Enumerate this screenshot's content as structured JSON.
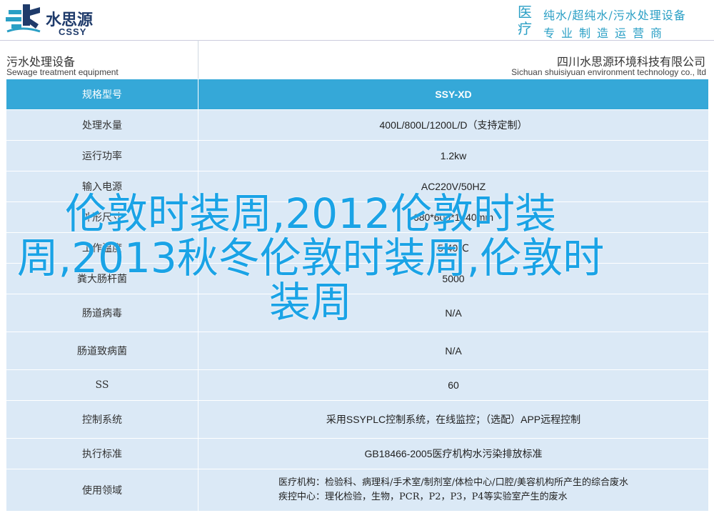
{
  "brand": {
    "name_cn": "水思源",
    "name_en": "CSSY"
  },
  "slogan": {
    "big": "医疗",
    "line1": "纯水/超纯水/污水处理设备",
    "line2": "专业制造运营商"
  },
  "header": {
    "left_cn": "污水处理设备",
    "left_en": "Sewage treatment equipment",
    "right_cn": "四川水思源环境科技有限公司",
    "right_en": "Sichuan shuisiyuan environment technology co., ltd"
  },
  "table": {
    "header": {
      "label": "规格型号",
      "value": "SSY-XD"
    },
    "rows": [
      {
        "label": "处理水量",
        "value": "400L/800L/1200L/D（支持定制）"
      },
      {
        "label": "运行功率",
        "value": "1.2kw"
      },
      {
        "label": "输入电源",
        "value": "AC220V/50HZ"
      },
      {
        "label": "外形尺寸",
        "value": "680*600*1440mm"
      },
      {
        "label": "工作温度",
        "value": "5-40℃"
      },
      {
        "label": "粪大肠杆菌",
        "value": "5000"
      },
      {
        "label": "肠道病毒",
        "value": "N/A"
      },
      {
        "label": "肠道致病菌",
        "value": "N/A"
      },
      {
        "label": "SS",
        "value": "60"
      },
      {
        "label": "控制系统",
        "value": "采用SSYPLC控制系统，在线监控；（选配）APP远程控制"
      },
      {
        "label": "执行标准",
        "value": "GB18466-2005医疗机构水污染排放标准"
      },
      {
        "label": "使用领域",
        "value_line1": "医疗机构：检验科、病理科/手术室/制剂室/体检中心/口腔/美容机构所产生的综合废水",
        "value_line2": "疾控中心：理化检验，生物，PCR，P2，P3，P4等实验室产生的废水"
      }
    ]
  },
  "overlay": {
    "title": "伦敦时装周,2012伦敦时装周,2013秋冬伦敦时装周,伦敦时装周"
  },
  "colors": {
    "accent": "#35a8d8",
    "row_bg": "#dbe9f6",
    "overlay": "#1aa3e6",
    "brand": "#1f3b6b"
  }
}
